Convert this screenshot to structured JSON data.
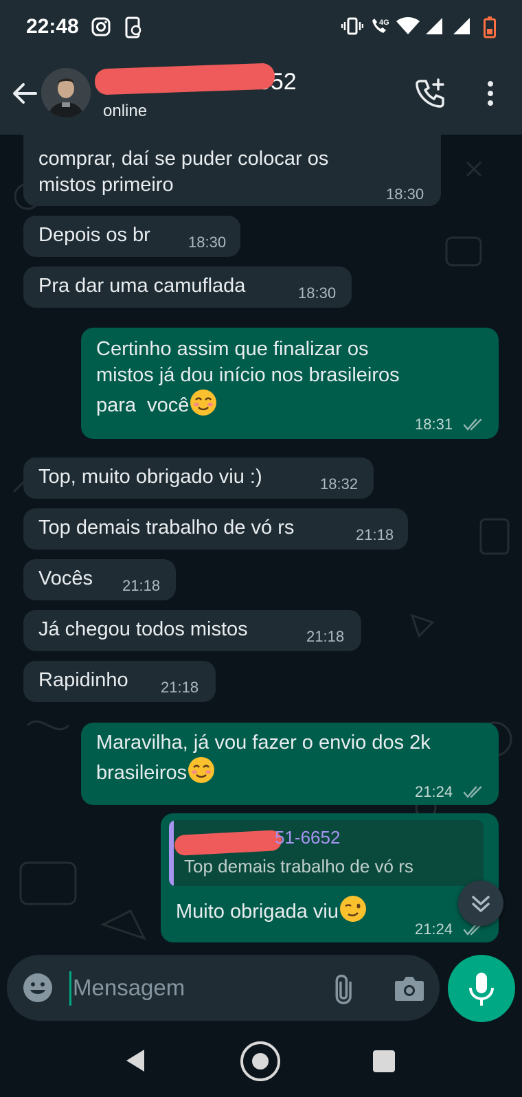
{
  "status_bar": {
    "time": "22:48",
    "icons": [
      "instagram-icon",
      "phone-link-icon",
      "vibrate-icon",
      "4g-call-icon",
      "wifi-icon",
      "signal-icon",
      "signal-icon",
      "battery-low-icon"
    ]
  },
  "header": {
    "contact_name_visible": "6652",
    "status": "online"
  },
  "messages": [
    {
      "dir": "in",
      "text": "comprar, daí se puder colocar os\nmistos primeiro",
      "time": "18:30"
    },
    {
      "dir": "in",
      "text": "Depois os br",
      "time": "18:30"
    },
    {
      "dir": "in",
      "text": "Pra dar uma camuflada",
      "time": "18:30"
    },
    {
      "dir": "out",
      "text": "Certinho assim que finalizar os\nmistos já dou início nos brasileiros\npara  você",
      "emoji": "☺",
      "time": "18:31",
      "status": "read"
    },
    {
      "dir": "in",
      "text": "Top, muito obrigado viu :)",
      "time": "18:32"
    },
    {
      "dir": "in",
      "text": "Top demais trabalho de vó rs",
      "time": "21:18"
    },
    {
      "dir": "in",
      "text": "Vocês",
      "time": "21:18"
    },
    {
      "dir": "in",
      "text": "Já chegou todos mistos",
      "time": "21:18"
    },
    {
      "dir": "in",
      "text": "Rapidinho",
      "time": "21:18"
    },
    {
      "dir": "out",
      "text": "Maravilha, já vou fazer o envio dos 2k\nbrasileiros",
      "emoji": "☺",
      "time": "21:24",
      "status": "read"
    },
    {
      "dir": "out",
      "quote_name_visible": "51-6652",
      "quote_text": "Top demais trabalho de vó rs",
      "text": "Muito obrigada viu",
      "emoji": "😉",
      "time": "21:24",
      "status": "read"
    }
  ],
  "compose": {
    "placeholder": "Mensagem"
  },
  "colors": {
    "header_bg": "#1f2c34",
    "chat_bg": "#0b141a",
    "incoming_bubble": "#1f2c34",
    "outgoing_bubble": "#005c4b",
    "accent": "#00a884",
    "quote_name": "#a793f0",
    "redaction": "#ef5a5a"
  }
}
